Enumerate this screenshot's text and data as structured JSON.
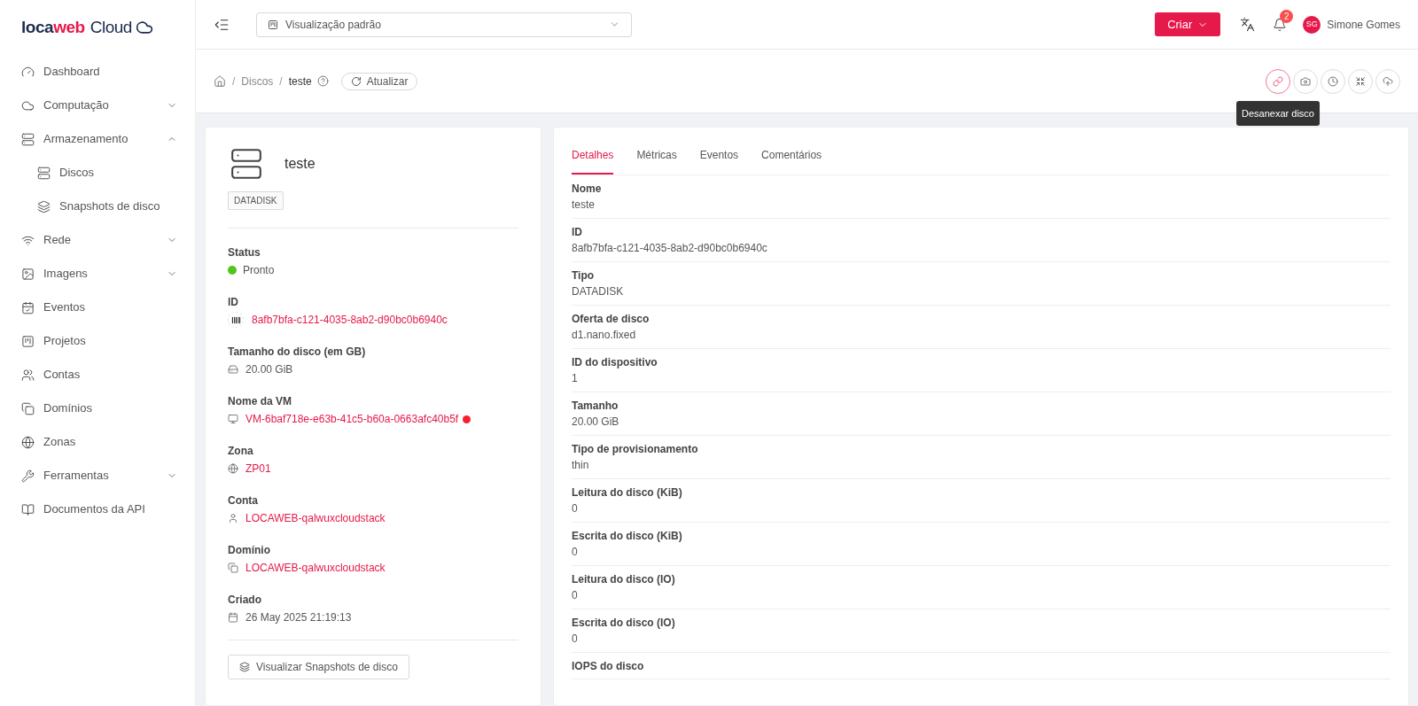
{
  "logo": {
    "part_1": "loca",
    "part_2": "web",
    "part_3": "Cloud"
  },
  "sidebar": {
    "items": [
      {
        "kind": "dashboard",
        "label": "Dashboard"
      },
      {
        "kind": "compute",
        "label": "Computação",
        "expanded": false
      },
      {
        "kind": "storage",
        "label": "Armazenamento",
        "expanded": true,
        "children": [
          {
            "kind": "disk",
            "label": "Discos"
          },
          {
            "kind": "snapshot",
            "label": "Snapshots de disco"
          }
        ]
      },
      {
        "kind": "network",
        "label": "Rede",
        "expanded": false
      },
      {
        "kind": "images",
        "label": "Imagens",
        "expanded": false
      },
      {
        "kind": "events",
        "label": "Eventos"
      },
      {
        "kind": "projects",
        "label": "Projetos"
      },
      {
        "kind": "accounts",
        "label": "Contas"
      },
      {
        "kind": "domains",
        "label": "Domínios"
      },
      {
        "kind": "zones",
        "label": "Zonas"
      },
      {
        "kind": "tools",
        "label": "Ferramentas",
        "expanded": false
      },
      {
        "kind": "docs",
        "label": "Documentos da API"
      }
    ]
  },
  "header": {
    "view_select": "Visualização padrão",
    "create_button": "Criar",
    "notification_count": "2",
    "user": {
      "initials": "SG",
      "name": "Simone Gomes"
    }
  },
  "breadcrumb": {
    "separator": "/",
    "items": [
      "Discos",
      "teste"
    ],
    "refresh_button": "Atualizar"
  },
  "actions": [
    {
      "kind": "link",
      "active": true
    },
    {
      "kind": "camera",
      "active": false
    },
    {
      "kind": "clock",
      "active": false
    },
    {
      "kind": "resize",
      "active": false
    },
    {
      "kind": "upload",
      "active": false
    }
  ],
  "tooltip": "Desanexar disco",
  "summary": {
    "name": "teste",
    "tag": "DATADISK",
    "fields": [
      {
        "kind": "status",
        "label": "Status",
        "value": "Pronto",
        "color": "#52c41a"
      },
      {
        "kind": "id",
        "label": "ID",
        "value": "8afb7bfa-c121-4035-8ab2-d90bc0b6940c"
      },
      {
        "kind": "size",
        "label": "Tamanho do disco (em GB)",
        "value": "20.00 GiB"
      },
      {
        "kind": "vm",
        "label": "Nome da VM",
        "value": "VM-6baf718e-e63b-41c5-b60a-0663afc40b5f",
        "color": "#f5222d"
      },
      {
        "kind": "zone",
        "label": "Zona",
        "value": "ZP01"
      },
      {
        "kind": "account",
        "label": "Conta",
        "value": "LOCAWEB-qalwuxcloudstack"
      },
      {
        "kind": "domain",
        "label": "Domínio",
        "value": "LOCAWEB-qalwuxcloudstack"
      },
      {
        "kind": "date",
        "label": "Criado",
        "value": "26 May 2025 21:19:13"
      }
    ],
    "snapshots_button": "Visualizar Snapshots de disco"
  },
  "details": {
    "tabs": [
      {
        "label": "Detalhes",
        "selected": true
      },
      {
        "label": "Métricas",
        "selected": false
      },
      {
        "label": "Eventos",
        "selected": false
      },
      {
        "label": "Comentários",
        "selected": false
      }
    ],
    "rows": [
      {
        "label": "Nome",
        "value": "teste"
      },
      {
        "label": "ID",
        "value": "8afb7bfa-c121-4035-8ab2-d90bc0b6940c"
      },
      {
        "label": "Tipo",
        "value": "DATADISK"
      },
      {
        "label": "Oferta de disco",
        "value": "d1.nano.fixed"
      },
      {
        "label": "ID do dispositivo",
        "value": "1"
      },
      {
        "label": "Tamanho",
        "value": "20.00 GiB"
      },
      {
        "label": "Tipo de provisionamento",
        "value": "thin"
      },
      {
        "label": "Leitura do disco (KiB)",
        "value": "0"
      },
      {
        "label": "Escrita do disco (KiB)",
        "value": "0"
      },
      {
        "label": "Leitura do disco (IO)",
        "value": "0"
      },
      {
        "label": "Escrita do disco (IO)",
        "value": "0"
      },
      {
        "label": "IOPS do disco"
      }
    ]
  }
}
